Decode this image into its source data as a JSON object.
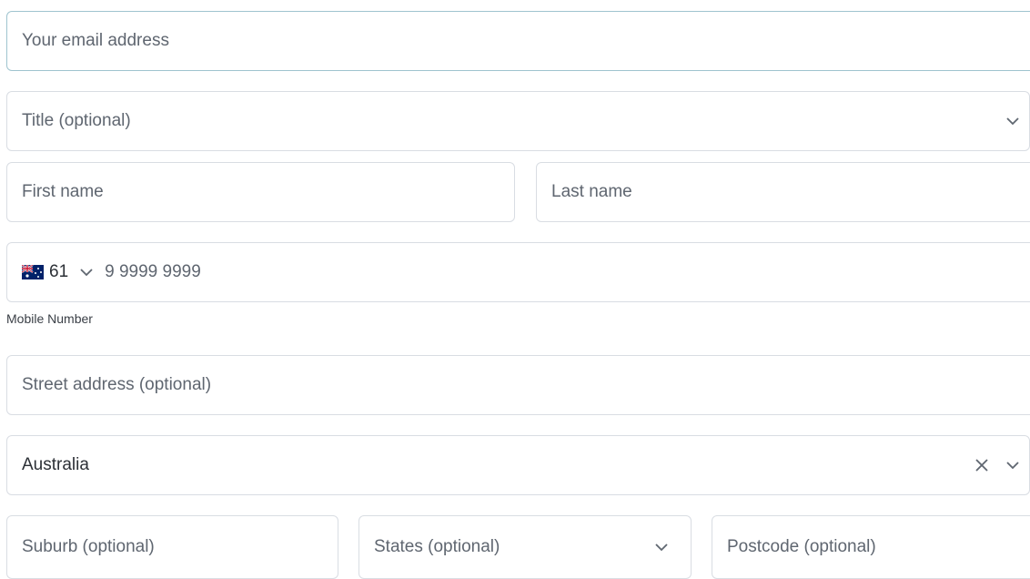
{
  "form": {
    "email": {
      "placeholder": "Your email address",
      "value": ""
    },
    "title": {
      "placeholder": "Title (optional)"
    },
    "first_name": {
      "placeholder": "First name",
      "value": ""
    },
    "last_name": {
      "placeholder": "Last name",
      "value": ""
    },
    "phone": {
      "country_code": "61",
      "placeholder": "9 9999 9999",
      "value": "",
      "helper": "Mobile Number",
      "flag_icon": "australia-flag-icon"
    },
    "street": {
      "placeholder": "Street address (optional)",
      "value": ""
    },
    "country": {
      "value": "Australia"
    },
    "suburb": {
      "placeholder": "Suburb (optional)",
      "value": ""
    },
    "state": {
      "placeholder": "States (optional)"
    },
    "postcode": {
      "placeholder": "Postcode (optional)",
      "value": ""
    }
  },
  "colors": {
    "border": "#d9dde3",
    "focus_border": "#9fc4cf",
    "placeholder": "#5f6670",
    "text": "#2c3036"
  }
}
